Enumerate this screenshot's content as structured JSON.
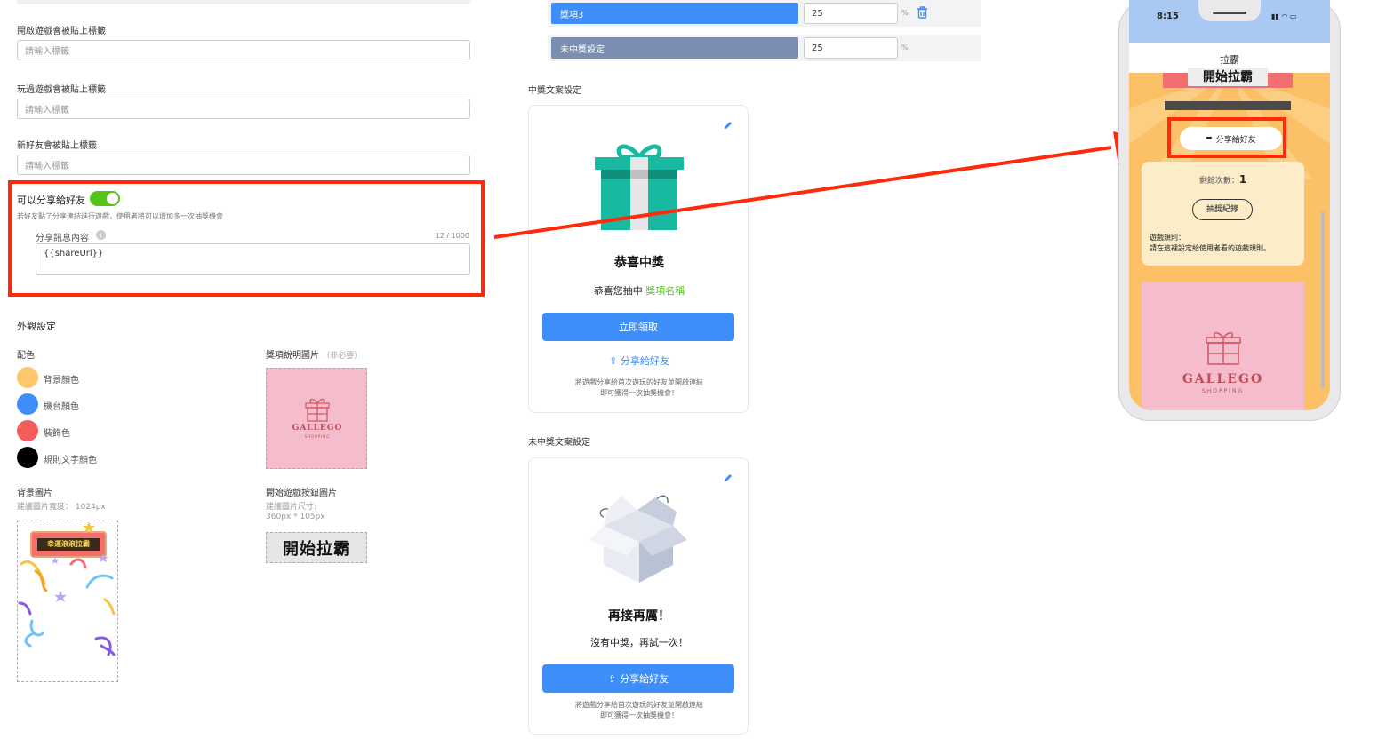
{
  "left": {
    "tags": [
      {
        "label": "開啟遊戲會被貼上標籤",
        "placeholder": "請輸入標籤"
      },
      {
        "label": "玩過遊戲會被貼上標籤",
        "placeholder": "請輸入標籤"
      },
      {
        "label": "新好友會被貼上標籤",
        "placeholder": "請輸入標籤"
      }
    ],
    "share": {
      "title": "可以分享給好友",
      "enabled": true,
      "desc": "若好友點了分享連結進行遊戲，使用者將可以增加多一次抽獎機會",
      "content_label": "分享訊息內容",
      "counter": "12 / 1000",
      "content_value": "{{shareUrl}}"
    },
    "appearance": {
      "title": "外觀設定",
      "color_label": "配色",
      "colors": [
        {
          "name": "背景顏色",
          "hex": "#fdc76b"
        },
        {
          "name": "機台顏色",
          "hex": "#3d8ef8"
        },
        {
          "name": "裝飾色",
          "hex": "#f45b5b"
        },
        {
          "name": "規則文字顏色",
          "hex": "#000000"
        }
      ],
      "prize_image_label": "獎項說明圖片",
      "prize_image_optional": "（非必要）",
      "bg_image_label": "背景圖片",
      "bg_image_hint": "建議圖片寬度： 1024px",
      "start_btn_label": "開始遊戲按鈕圖片",
      "start_btn_hint1": "建議圖片尺寸:",
      "start_btn_hint2": "360px * 105px",
      "start_btn_text": "開始拉霸",
      "bg_banner_text": "幸運滾滾拉霸",
      "logo_text": "GALLEGO",
      "logo_sub": "SHOPPING"
    }
  },
  "middle": {
    "prizes": [
      {
        "name": "獎項3",
        "value": "25",
        "unit": "%",
        "color": "#3d8ef8"
      },
      {
        "name": "未中獎設定",
        "value": "25",
        "unit": "%",
        "color": "#7b8db0"
      }
    ],
    "win": {
      "section_title": "中獎文案設定",
      "heading": "恭喜中獎",
      "line_prefix": "恭喜您抽中",
      "line_prize": "獎項名稱",
      "claim_btn": "立即領取",
      "share_link": "分享給好友",
      "note1": "將遊戲分享給首次遊玩的好友並開啟連結",
      "note2": "即可獲得一次抽獎機會！"
    },
    "lose": {
      "section_title": "未中獎文案設定",
      "heading": "再接再厲！",
      "line": "沒有中獎，再試一次！",
      "share_btn": "分享給好友",
      "note1": "將遊戲分享給首次遊玩的好友並開啟連結",
      "note2": "即可獲得一次抽獎機會！"
    }
  },
  "phone": {
    "time": "8:15",
    "title": "拉霸",
    "start_text": "開始拉霸",
    "share_btn": "分享給好友",
    "remaining_label": "剩餘次數：",
    "remaining_value": "1",
    "records_btn": "抽獎紀錄",
    "rules_title": "遊戲規則：",
    "rules_text": "請在這裡設定給使用者看的遊戲規則。",
    "logo_text": "GALLEGO",
    "logo_sub": "SHOPPING"
  }
}
